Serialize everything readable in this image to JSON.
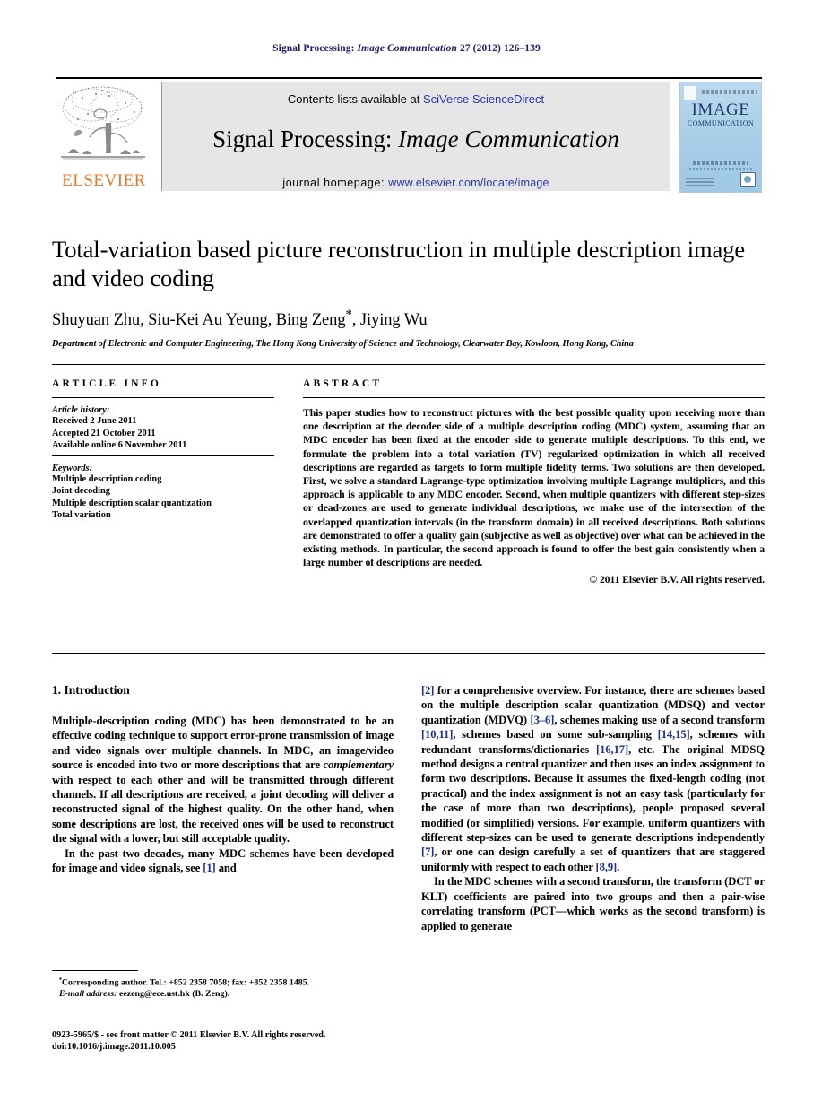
{
  "running_head": {
    "journal_plain": "Signal Processing:",
    "journal_italic": "Image Communication",
    "citation": "27 (2012) 126–139"
  },
  "masthead": {
    "contents_prefix": "Contents lists available at",
    "contents_link": "SciVerse ScienceDirect",
    "journal_name_plain": "Signal Processing:",
    "journal_name_italic": "Image Communication",
    "homepage_prefix": "journal homepage:",
    "homepage_link": "www.elsevier.com/locate/image",
    "publisher_wordmark": "ELSEVIER",
    "cover_title": "IMAGE",
    "cover_subtitle": "COMMUNICATION",
    "colors": {
      "link": "#2b37a8",
      "elsevier_orange": "#E87722",
      "band_gray": "#e6e6e6",
      "running_head_navy": "#1a1a6e",
      "cover_blue": "#a9cfe8"
    }
  },
  "article": {
    "title": "Total-variation based picture reconstruction in multiple description image and video coding",
    "authors": "Shuyuan Zhu, Siu-Kei Au Yeung, Bing Zeng",
    "authors_tail": ", Jiying Wu",
    "corresponding_marker": "*",
    "affiliation": "Department of Electronic and Computer Engineering, The Hong Kong University of Science and Technology, Clearwater Bay, Kowloon, Hong Kong, China"
  },
  "article_info": {
    "heading": "ARTICLE INFO",
    "history_label": "Article history:",
    "history": [
      "Received 2 June 2011",
      "Accepted 21 October 2011",
      "Available online 6 November 2011"
    ],
    "keywords_label": "Keywords:",
    "keywords": [
      "Multiple description coding",
      "Joint decoding",
      "Multiple description scalar quantization",
      "Total variation"
    ]
  },
  "abstract": {
    "heading": "ABSTRACT",
    "text": "This paper studies how to reconstruct pictures with the best possible quality upon receiving more than one description at the decoder side of a multiple description coding (MDC) system, assuming that an MDC encoder has been fixed at the encoder side to generate multiple descriptions. To this end, we formulate the problem into a total variation (TV) regularized optimization in which all received descriptions are regarded as targets to form multiple fidelity terms. Two solutions are then developed. First, we solve a standard Lagrange-type optimization involving multiple Lagrange multipliers, and this approach is applicable to any MDC encoder. Second, when multiple quantizers with different step-sizes or dead-zones are used to generate individual descriptions, we make use of the intersection of the overlapped quantization intervals (in the transform domain) in all received descriptions. Both solutions are demonstrated to offer a quality gain (subjective as well as objective) over what can be achieved in the existing methods. In particular, the second approach is found to offer the best gain consistently when a large number of descriptions are needed.",
    "copyright": "© 2011 Elsevier B.V. All rights reserved."
  },
  "body": {
    "section_number_title": "1.  Introduction",
    "left_paragraphs": [
      {
        "segments": [
          {
            "t": "Multiple-description coding (MDC) has been demonstrated to be an effective coding technique to support error-prone transmission of image and video signals over multiple channels. In MDC, an image/video source is encoded into two or more descriptions that are ",
            "style": "normal"
          },
          {
            "t": "complementary",
            "style": "italic"
          },
          {
            "t": " with respect to each other and will be transmitted through different channels. If all descriptions are received, a joint decoding will deliver a reconstructed signal of the highest quality. On the other hand, when some descriptions are lost, the received ones will be used to reconstruct the signal with a lower, but still acceptable quality.",
            "style": "normal"
          }
        ]
      },
      {
        "segments": [
          {
            "t": "In the past two decades, many MDC schemes have been developed for image and video signals, see ",
            "style": "normal"
          },
          {
            "t": "[1]",
            "style": "ref"
          },
          {
            "t": " and",
            "style": "normal"
          }
        ]
      }
    ],
    "right_paragraphs": [
      {
        "segments": [
          {
            "t": "[2]",
            "style": "ref"
          },
          {
            "t": " for a comprehensive overview. For instance, there are schemes based on the multiple description scalar quantization (MDSQ) and vector quantization (MDVQ) ",
            "style": "normal"
          },
          {
            "t": "[3–6]",
            "style": "ref"
          },
          {
            "t": ", schemes making use of a second transform ",
            "style": "normal"
          },
          {
            "t": "[10,11]",
            "style": "ref"
          },
          {
            "t": ", schemes based on some sub-sampling ",
            "style": "normal"
          },
          {
            "t": "[14,15]",
            "style": "ref"
          },
          {
            "t": ", schemes with redundant transforms/dictionaries ",
            "style": "normal"
          },
          {
            "t": "[16,17]",
            "style": "ref"
          },
          {
            "t": ", etc. The original MDSQ method designs a central quantizer and then uses an index assignment to form two descriptions. Because it assumes the fixed-length coding (not practical) and the index assignment is not an easy task (particularly for the case of more than two descriptions), people proposed several modified (or simplified) versions. For example, uniform quantizers with different step-sizes can be used to generate descriptions independently ",
            "style": "normal"
          },
          {
            "t": "[7]",
            "style": "ref"
          },
          {
            "t": ", or one can design carefully a set of quantizers that are staggered uniformly with respect to each other ",
            "style": "normal"
          },
          {
            "t": "[8,9]",
            "style": "ref"
          },
          {
            "t": ".",
            "style": "normal"
          }
        ]
      },
      {
        "segments": [
          {
            "t": "In the MDC schemes with a second transform, the transform (DCT or KLT) coefficients are paired into two groups and then a pair-wise correlating transform (PCT—which works as the second transform) is applied to generate",
            "style": "normal"
          }
        ]
      }
    ]
  },
  "footnote": {
    "corresponding": "Corresponding author. Tel.: +852 2358 7058; fax: +852 2358 1485.",
    "email_label": "E-mail address:",
    "email_value": "eezeng@ece.ust.hk (B. Zeng)."
  },
  "imprint": {
    "line1": "0923-5965/$ - see front matter © 2011 Elsevier B.V. All rights reserved.",
    "line2": "doi:10.1016/j.image.2011.10.005"
  }
}
